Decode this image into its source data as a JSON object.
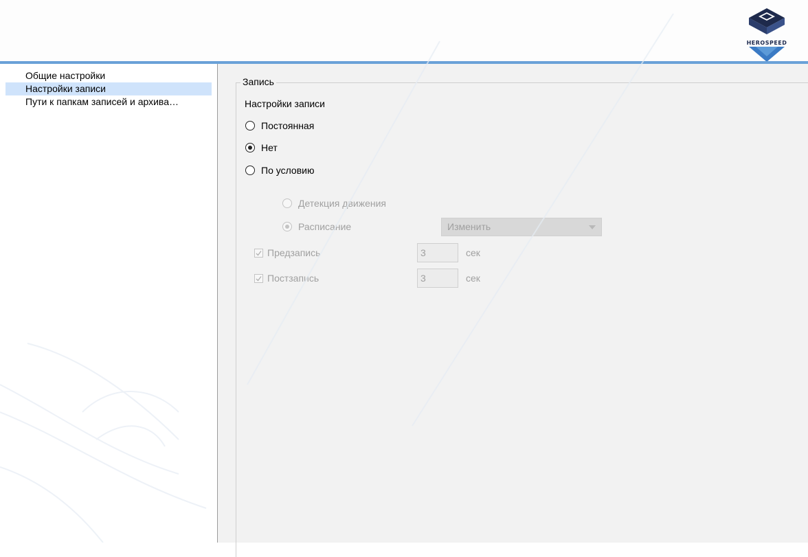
{
  "header": {
    "logo_text": "HEROSPEED",
    "logo_icon": "herospeed-logo-icon"
  },
  "sidebar": {
    "items": [
      {
        "label": "Общие настройки",
        "selected": false
      },
      {
        "label": "Настройки записи",
        "selected": true
      },
      {
        "label": "Пути к папкам записей и архива…",
        "selected": false
      }
    ]
  },
  "main": {
    "group_title": "Запись",
    "section_label": "Настройки записи",
    "mode_options": [
      {
        "label": "Постоянная",
        "checked": false
      },
      {
        "label": "Нет",
        "checked": true
      },
      {
        "label": "По условию",
        "checked": false
      }
    ],
    "condition_options": [
      {
        "label": "Детекция движения",
        "checked": false
      },
      {
        "label": "Расписание",
        "checked": true
      }
    ],
    "schedule_select": {
      "value": "Изменить"
    },
    "prerecord": {
      "label": "Предзапись",
      "checked": true,
      "value": "3",
      "unit": "сек"
    },
    "postrecord": {
      "label": "Постзапись",
      "checked": true,
      "value": "3",
      "unit": "сек"
    }
  },
  "colors": {
    "accent_line": "#6aa1d8",
    "selected_bg": "#cfe3fb",
    "panel_bg": "#f2f2f2"
  }
}
